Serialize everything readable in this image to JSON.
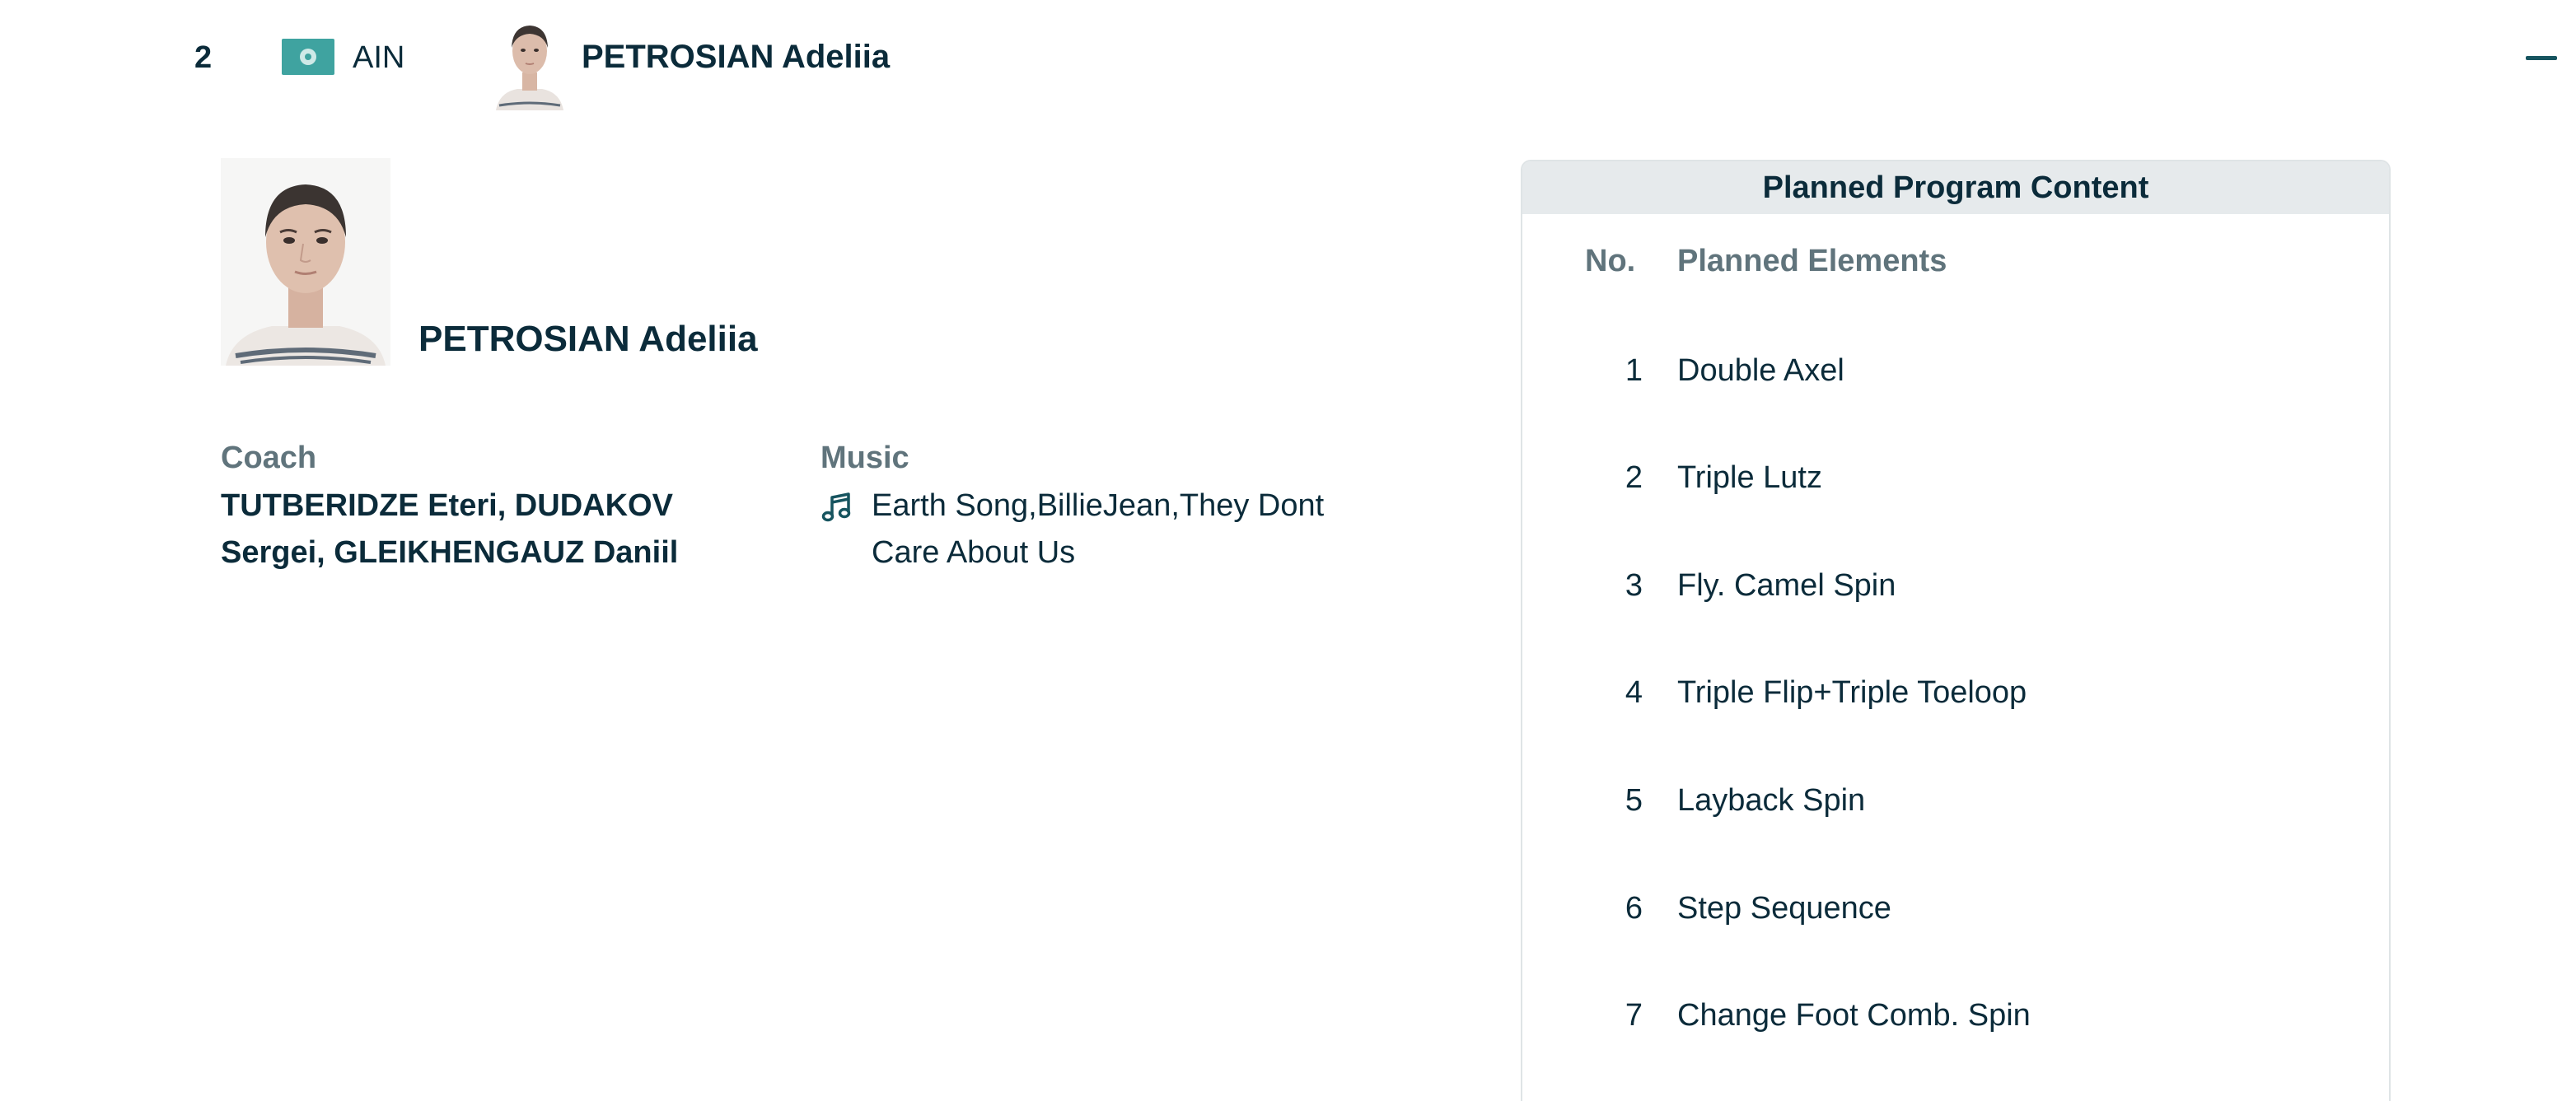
{
  "header": {
    "rank": "2",
    "nation_code": "AIN",
    "athlete_name": "PETROSIAN Adeliia",
    "flag_color": "#3fa3a0",
    "collapse_icon": "minus-icon"
  },
  "athlete": {
    "name": "PETROSIAN Adeliia",
    "coach_label": "Coach",
    "coach_value": "TUTBERIDZE Eteri, DUDAKOV Sergei, GLEIKHENGAUZ Daniil",
    "music_label": "Music",
    "music_icon": "music-note-icon",
    "music_value": "Earth Song,BillieJean,They Dont Care About Us"
  },
  "program": {
    "title": "Planned Program Content",
    "col_no": "No.",
    "col_elements": "Planned Elements",
    "elements": [
      {
        "no": "1",
        "name": "Double Axel"
      },
      {
        "no": "2",
        "name": "Triple Lutz"
      },
      {
        "no": "3",
        "name": "Fly. Camel Spin"
      },
      {
        "no": "4",
        "name": "Triple Flip+Triple Toeloop"
      },
      {
        "no": "5",
        "name": "Layback Spin"
      },
      {
        "no": "6",
        "name": "Step Sequence"
      },
      {
        "no": "7",
        "name": "Change Foot Comb. Spin"
      }
    ]
  },
  "colors": {
    "text_primary": "#0b2b3a",
    "text_muted": "#60747c",
    "accent": "#16545f",
    "panel_header_bg": "#e6eaec"
  }
}
